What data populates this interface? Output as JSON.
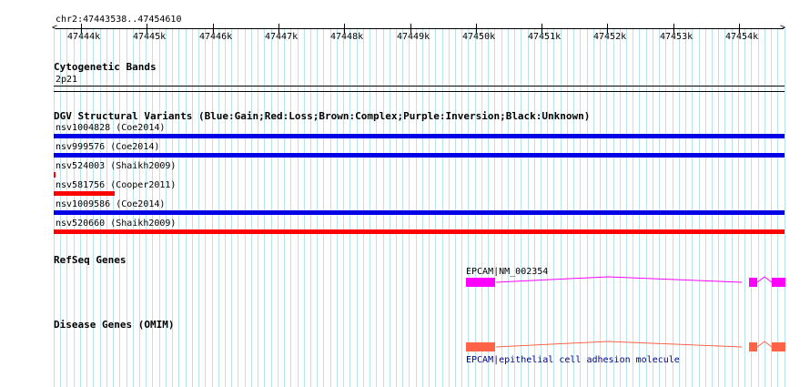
{
  "ruler": {
    "range_label": "chr2:47443538..47454610",
    "ticks": [
      "47444k",
      "47445k",
      "47446k",
      "47447k",
      "47448k",
      "47449k",
      "47450k",
      "47451k",
      "47452k",
      "47453k",
      "47454k"
    ]
  },
  "tracks": {
    "cytoband": {
      "title": "Cytogenetic Bands",
      "band_label": "2p21"
    },
    "dgv": {
      "title": "DGV Structural Variants (Blue:Gain;Red:Loss;Brown:Complex;Purple:Inversion;Black:Unknown)",
      "colors": {
        "gain": "#0000e6",
        "loss": "#ff0000"
      },
      "variants": [
        {
          "label": "nsv1004828 (Coe2014)",
          "type": "gain",
          "start_fraction": 0.0,
          "end_fraction": 1.0
        },
        {
          "label": "nsv999576 (Coe2014)",
          "type": "gain",
          "start_fraction": 0.0,
          "end_fraction": 1.0
        },
        {
          "label": "nsv524003 (Shaikh2009)",
          "type": "loss",
          "start_fraction": 0.0,
          "end_fraction": 0.003
        },
        {
          "label": "nsv581756 (Cooper2011)",
          "type": "loss",
          "start_fraction": 0.0,
          "end_fraction": 0.083
        },
        {
          "label": "nsv1009586 (Coe2014)",
          "type": "gain",
          "start_fraction": 0.0,
          "end_fraction": 1.0
        },
        {
          "label": "nsv520660 (Shaikh2009)",
          "type": "loss",
          "start_fraction": 0.0,
          "end_fraction": 1.0
        }
      ]
    },
    "refseq": {
      "title": "RefSeq Genes",
      "gene_label": "EPCAM|NM_002354",
      "color": "#ff00ff"
    },
    "disease": {
      "title": "Disease Genes (OMIM)",
      "gene_label": "EPCAM|epithelial cell adhesion molecule",
      "color": "#ff6347",
      "label_color": "#00008b"
    }
  }
}
